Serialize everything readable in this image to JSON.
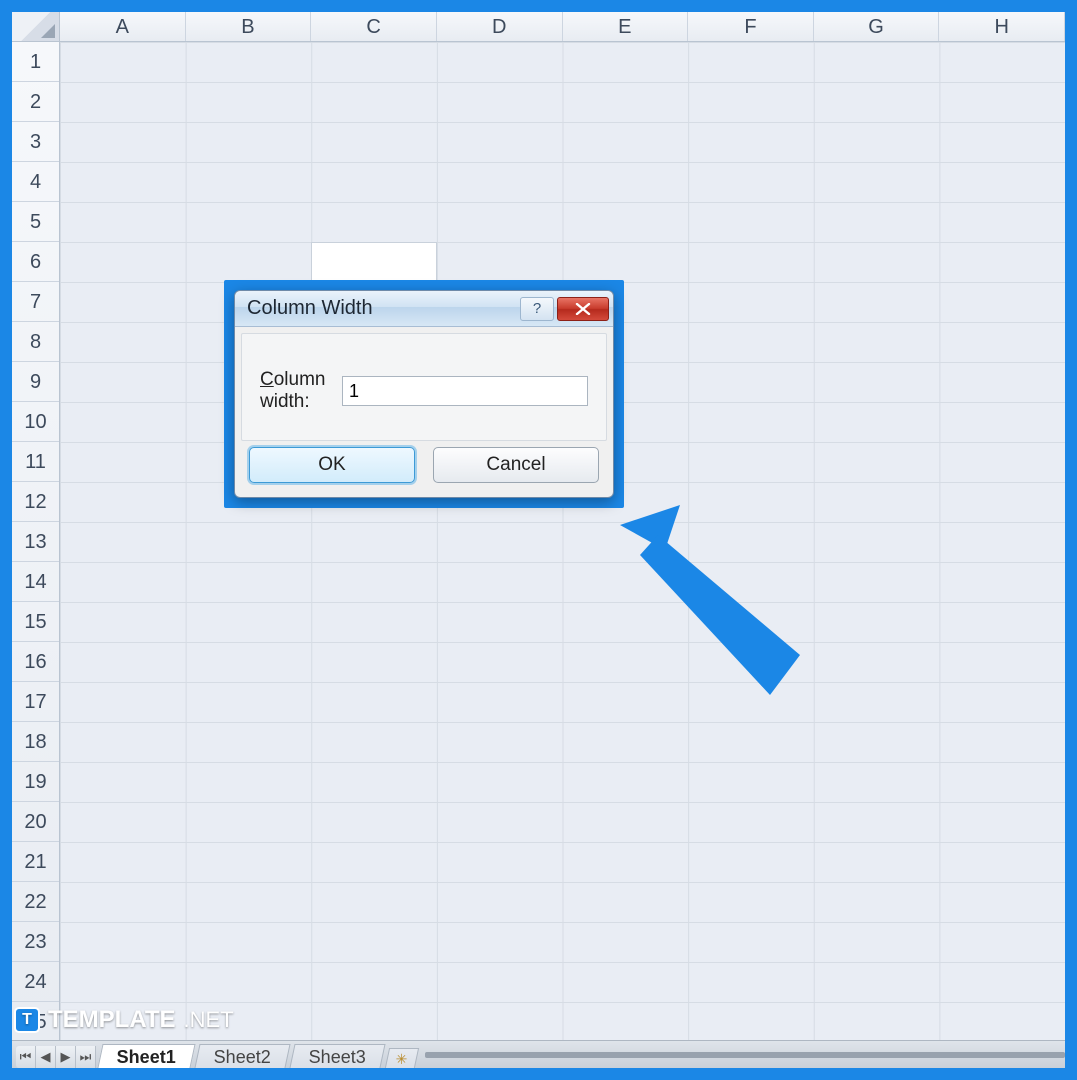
{
  "columns": [
    "A",
    "B",
    "C",
    "D",
    "E",
    "F",
    "G",
    "H"
  ],
  "rows": [
    "1",
    "2",
    "3",
    "4",
    "5",
    "6",
    "7",
    "8",
    "9",
    "10",
    "11",
    "12",
    "13",
    "14",
    "15",
    "16",
    "17",
    "18",
    "19",
    "20",
    "21",
    "22",
    "23",
    "24",
    "25"
  ],
  "dialog": {
    "title": "Column Width",
    "label_prefix": "C",
    "label_rest": "olumn width:",
    "input_value": "1",
    "ok": "OK",
    "cancel": "Cancel",
    "help": "?",
    "close_icon": "close"
  },
  "sheets": {
    "nav": [
      "⏮",
      "◀",
      "▶",
      "⏭"
    ],
    "tabs": [
      "Sheet1",
      "Sheet2",
      "Sheet3"
    ],
    "active": "Sheet1",
    "new_icon": "✳"
  },
  "watermark": {
    "logo": "T",
    "brand": "TEMPLATE",
    "tld": ".NET"
  }
}
